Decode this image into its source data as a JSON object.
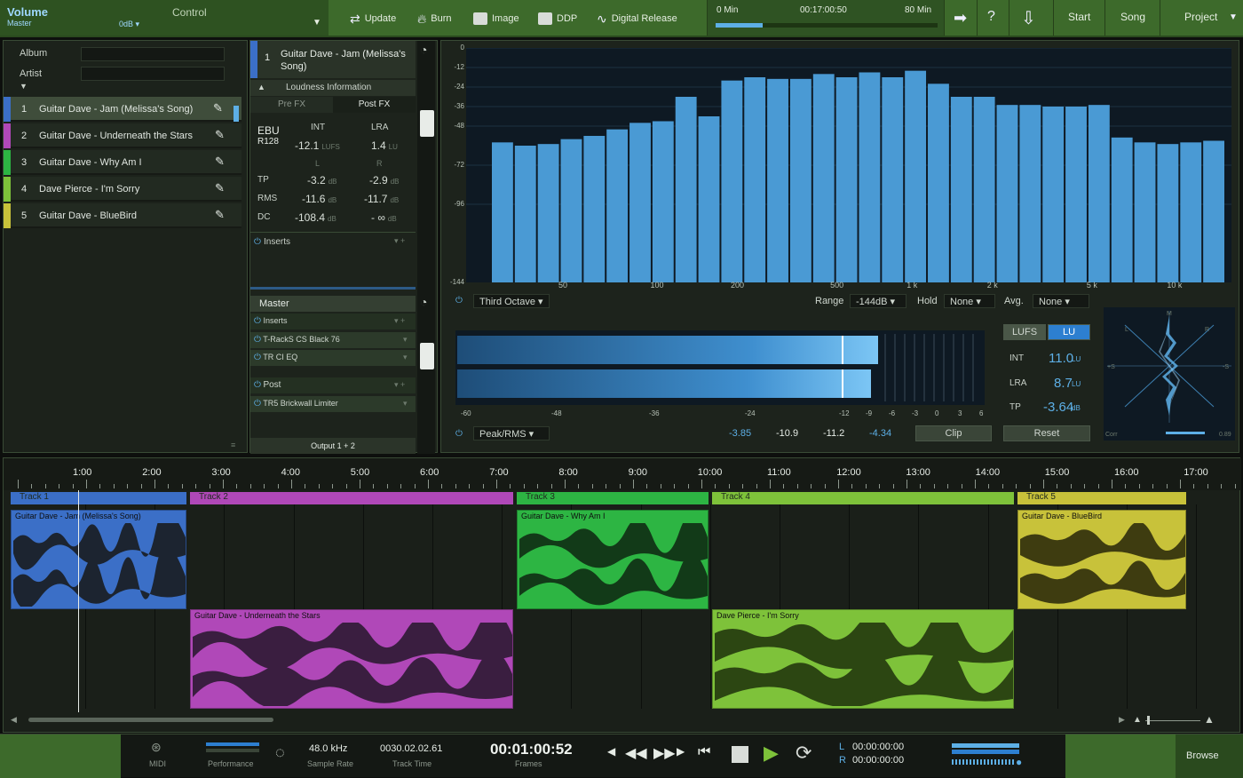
{
  "topbar": {
    "volume_label": "Volume",
    "master_label": "Master",
    "control_label": "Control",
    "db_value": "0dB",
    "buttons": [
      "Update",
      "Burn",
      "Image",
      "DDP",
      "Digital Release"
    ],
    "timeline": {
      "start": "0 Min",
      "current": "00:17:00:50",
      "end": "80 Min",
      "progress": 0.21
    },
    "nav": [
      "Start",
      "Song",
      "Project"
    ],
    "help": "?"
  },
  "left": {
    "album_label": "Album",
    "artist_label": "Artist",
    "album_value": "",
    "artist_value": "",
    "tracks": [
      {
        "num": "1",
        "name": "Guitar Dave - Jam (Melissa's Song)",
        "color": "#3b6fc7"
      },
      {
        "num": "2",
        "name": "Guitar Dave - Underneath the Stars",
        "color": "#b048b8"
      },
      {
        "num": "3",
        "name": "Guitar Dave - Why Am I",
        "color": "#2db543"
      },
      {
        "num": "4",
        "name": "Dave Pierce - I'm Sorry",
        "color": "#7ec23a"
      },
      {
        "num": "5",
        "name": "Guitar Dave - BlueBird",
        "color": "#c8c23a"
      }
    ]
  },
  "mid": {
    "track_num": "1",
    "track_title": "Guitar Dave - Jam (Melissa's Song)",
    "loudness_label": "Loudness Information",
    "tab_pre": "Pre FX",
    "tab_post": "Post FX",
    "ebu": "EBU",
    "r128": "R128",
    "int_label": "INT",
    "lra_label": "LRA",
    "int_value": "-12.1",
    "int_unit": "LUFS",
    "lra_value": "1.4",
    "lra_unit": "LU",
    "l_label": "L",
    "r_label": "R",
    "rows": [
      {
        "label": "TP",
        "l": "-3.2",
        "r": "-2.9",
        "unit": "dB"
      },
      {
        "label": "RMS",
        "l": "-11.6",
        "r": "-11.7",
        "unit": "dB"
      },
      {
        "label": "DC",
        "l": "-108.4",
        "r": "- ∞",
        "unit": "dB"
      }
    ],
    "inserts_label": "Inserts",
    "master_label": "Master",
    "master_inserts_label": "Inserts",
    "plugins": [
      "T-RackS CS Black 76",
      "TR CI EQ"
    ],
    "post_label": "Post",
    "post_plugins": [
      "TR5 Brickwall Limiter"
    ],
    "output_label": "Output 1 + 2"
  },
  "spectrum": {
    "mode": "Third Octave",
    "range_label": "Range",
    "range_value": "-144dB",
    "hold_label": "Hold",
    "hold_value": "None",
    "avg_label": "Avg.",
    "avg_value": "None",
    "meter_mode": "Peak/RMS",
    "readouts": [
      "-3.85",
      "-10.9",
      "-11.2",
      "-4.34"
    ],
    "clip_label": "Clip",
    "reset_label": "Reset",
    "lufs_tab": "LUFS",
    "lu_tab": "LU",
    "lu_rows": [
      {
        "label": "INT",
        "value": "11.0",
        "unit": "LU"
      },
      {
        "label": "LRA",
        "value": "8.7",
        "unit": "LU"
      },
      {
        "label": "TP",
        "value": "-3.64",
        "unit": "dB"
      }
    ],
    "meter_scale": [
      "-60",
      "-48",
      "-36",
      "-24",
      "-12",
      "-9",
      "-6",
      "-3",
      "0",
      "3",
      "6"
    ],
    "scope_corr": "Corr",
    "scope_value": "0.89",
    "scope_l": "L",
    "scope_r": "R",
    "scope_m": "M",
    "scope_pos": "+S",
    "scope_neg": "-S"
  },
  "chart_data": {
    "type": "bar",
    "ylim": [
      -144,
      0
    ],
    "yticks": [
      "0",
      "-12",
      "-24",
      "-36",
      "-48",
      "-72",
      "-96",
      "-144"
    ],
    "xticks": [
      "50",
      "100",
      "200",
      "500",
      "1 k",
      "2 k",
      "5 k",
      "10 k"
    ],
    "values": [
      -58,
      -60,
      -59,
      -56,
      -54,
      -50,
      -46,
      -45,
      -30,
      -42,
      -20,
      -18,
      -19,
      -19,
      -16,
      -18,
      -15,
      -18,
      -14,
      -22,
      -30,
      -30,
      -35,
      -35,
      -36,
      -36,
      -35,
      -55,
      -58,
      -59,
      -58,
      -57
    ]
  },
  "arrangement": {
    "ruler": [
      "1:00",
      "2:00",
      "3:00",
      "4:00",
      "5:00",
      "6:00",
      "7:00",
      "8:00",
      "9:00",
      "10:00",
      "11:00",
      "12:00",
      "13:00",
      "14:00",
      "15:00",
      "16:00",
      "17:00"
    ],
    "tracks": [
      {
        "label": "Track 1",
        "clip": "Guitar Dave - Jam (Melissa's Song)",
        "color": "#3b6fc7"
      },
      {
        "label": "Track 2",
        "clip": "Guitar Dave - Underneath the Stars",
        "color": "#b048b8"
      },
      {
        "label": "Track 3",
        "clip": "Guitar Dave - Why Am I",
        "color": "#2db543"
      },
      {
        "label": "Track 4",
        "clip": "Dave Pierce - I'm Sorry",
        "color": "#7ec23a"
      },
      {
        "label": "Track 5",
        "clip": "Guitar Dave - BlueBird",
        "color": "#c8c23a"
      }
    ]
  },
  "transport": {
    "midi": "MIDI",
    "performance": "Performance",
    "sample_rate_value": "48.0 kHz",
    "sample_rate_label": "Sample Rate",
    "track_time_value": "0030.02.02.61",
    "track_time_label": "Track Time",
    "frames_value": "00:01:00:52",
    "frames_label": "Frames",
    "l_label": "L",
    "r_label": "R",
    "l_time": "00:00:00:00",
    "r_time": "00:00:00:00",
    "browse": "Browse"
  }
}
